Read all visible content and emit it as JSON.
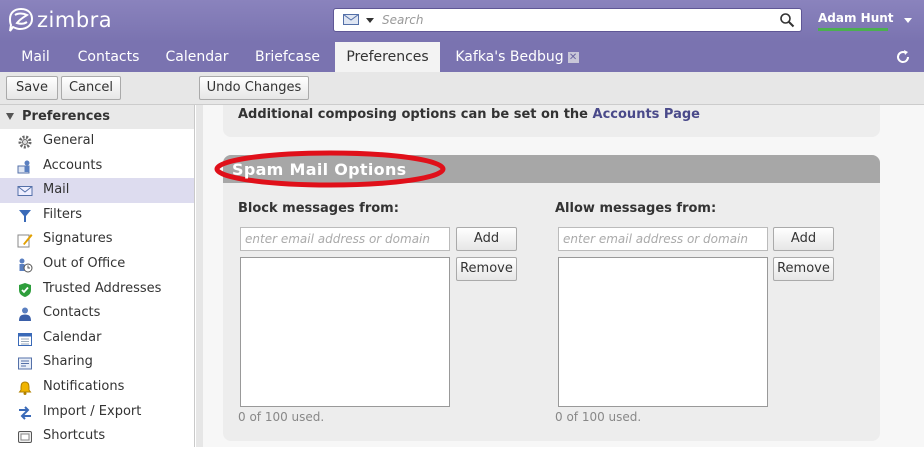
{
  "app": {
    "logo_text": "zimbra"
  },
  "search": {
    "placeholder": "Search"
  },
  "user": {
    "name": "Adam Hunt"
  },
  "tabs": [
    {
      "label": "Mail"
    },
    {
      "label": "Contacts"
    },
    {
      "label": "Calendar"
    },
    {
      "label": "Briefcase"
    },
    {
      "label": "Preferences"
    },
    {
      "label": "Kafka's Bedbug"
    }
  ],
  "toolbar": {
    "save": "Save",
    "cancel": "Cancel",
    "undo": "Undo Changes"
  },
  "sidebar": {
    "header": "Preferences",
    "items": [
      {
        "label": "General",
        "icon": "gear-icon"
      },
      {
        "label": "Accounts",
        "icon": "accounts-icon"
      },
      {
        "label": "Mail",
        "icon": "mail-icon"
      },
      {
        "label": "Filters",
        "icon": "filter-icon"
      },
      {
        "label": "Signatures",
        "icon": "signature-icon"
      },
      {
        "label": "Out of Office",
        "icon": "out-of-office-icon"
      },
      {
        "label": "Trusted Addresses",
        "icon": "shield-icon"
      },
      {
        "label": "Contacts",
        "icon": "contacts-icon"
      },
      {
        "label": "Calendar",
        "icon": "calendar-icon"
      },
      {
        "label": "Sharing",
        "icon": "sharing-icon"
      },
      {
        "label": "Notifications",
        "icon": "bell-icon"
      },
      {
        "label": "Import / Export",
        "icon": "import-export-icon"
      },
      {
        "label": "Shortcuts",
        "icon": "keyboard-icon"
      }
    ]
  },
  "main": {
    "compose_note_prefix": "Additional composing options can be set on the",
    "compose_note_link": "Accounts Page",
    "spam_title": "Spam Mail Options",
    "block": {
      "label": "Block messages from:",
      "placeholder": "enter email address or domain",
      "add": "Add",
      "remove": "Remove",
      "usage": "0 of 100 used."
    },
    "allow": {
      "label": "Allow messages from:",
      "placeholder": "enter email address or domain",
      "add": "Add",
      "remove": "Remove",
      "usage": "0 of 100 used."
    }
  },
  "colors": {
    "header_bg": "#7a73b0",
    "annotation": "#e0101a",
    "selected_row": "#dddcef"
  }
}
